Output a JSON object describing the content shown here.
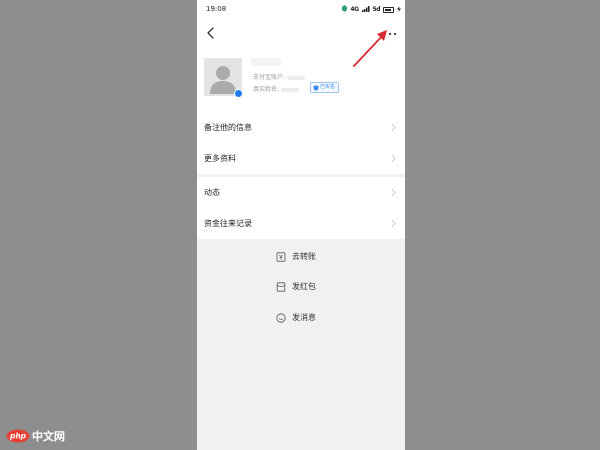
{
  "status_bar": {
    "time": "19:08",
    "signal_left": "4G",
    "signal_right": "5d"
  },
  "nav": {
    "back_icon": "chevron-left-icon",
    "more_icon": "more-horizontal-icon"
  },
  "profile": {
    "line1": "支付宝账户:",
    "line2": "真实姓名:",
    "verify_tag": "已实名"
  },
  "sections": {
    "info": [
      {
        "label": "备注他的信息"
      },
      {
        "label": "更多资料"
      }
    ],
    "activity": [
      {
        "label": "动态"
      },
      {
        "label": "资金往来记录"
      }
    ]
  },
  "actions": [
    {
      "label": "去转账",
      "icon": "transfer-icon"
    },
    {
      "label": "发红包",
      "icon": "red-packet-icon"
    },
    {
      "label": "发消息",
      "icon": "message-icon"
    }
  ],
  "watermark": {
    "text": "中文网",
    "logo_text": "php"
  },
  "colors": {
    "background_outer": "#8e8e8e",
    "annotation_arrow": "#d9282f",
    "accent_blue": "#1f7bef"
  }
}
